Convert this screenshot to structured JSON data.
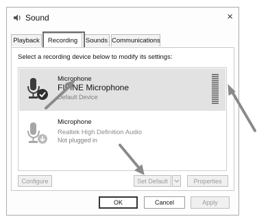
{
  "window": {
    "title": "Sound",
    "close_glyph": "×"
  },
  "tabs": [
    {
      "label": "Playback"
    },
    {
      "label": "Recording"
    },
    {
      "label": "Sounds"
    },
    {
      "label": "Communications"
    }
  ],
  "instruction": "Select a recording device below to modify its settings:",
  "devices": [
    {
      "name": "Microphone",
      "description": "FIFINE Microphone",
      "status": "Default Device",
      "icon": "microphone-icon",
      "badge": "checkmark-badge"
    },
    {
      "name": "Microphone",
      "description": "Realtek High Definition Audio",
      "status": "Not plugged in",
      "icon": "microphone-icon",
      "badge": "down-arrow-badge"
    }
  ],
  "buttons": {
    "configure": "Configure",
    "set_default": "Set Default",
    "properties": "Properties",
    "ok": "OK",
    "cancel": "Cancel",
    "apply": "Apply"
  },
  "colors": {
    "selected_row": "#e2e2e2",
    "annotation_arrow": "#8a8a8a"
  }
}
